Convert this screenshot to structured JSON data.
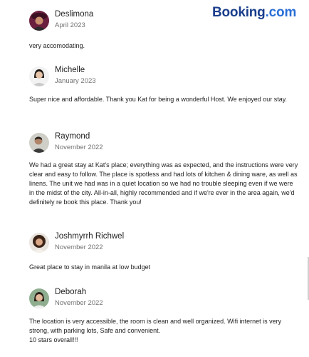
{
  "brand": {
    "name": "Booking",
    "suffix": ".com",
    "colors": {
      "primary": "#1a3e8c",
      "accent": "#2a6fd6"
    }
  },
  "reviews": [
    {
      "name": "Deslimona",
      "date": "April 2023",
      "avatar_icon": "avatar-photo-woman-hat",
      "text": "very accomodating."
    },
    {
      "name": "Michelle",
      "date": "January 2023",
      "avatar_icon": "avatar-photo-woman",
      "text": "Super nice and affordable. Thank you Kat for being a wonderful Host. We enjoyed our stay."
    },
    {
      "name": "Raymond",
      "date": "November 2022",
      "avatar_icon": "avatar-photo-man",
      "text": "We had a great stay at Kat's place; everything was as expected, and the instructions were very clear and easy to follow. The place is spotless and had lots of kitchen & dining ware, as well as linens. The unit we had was in a quiet location so we had no trouble sleeping even if we were in the midst of the city. All-in-all, highly recommended and if we're ever in the area again, we'd definitely re book this place. Thank you!"
    },
    {
      "name": "Joshmyrrh Richwel",
      "date": "November 2022",
      "avatar_icon": "avatar-photo-woman-curly",
      "text": "Great place to stay in manila at low budget"
    },
    {
      "name": "Deborah",
      "date": "November 2022",
      "avatar_icon": "avatar-photo-woman-green",
      "text": "The location is very accessible, the room is clean and well organized. Wifi internet is very strong, with parking lots, Safe and convenient.",
      "text2": "10 stars overall!!!"
    }
  ]
}
